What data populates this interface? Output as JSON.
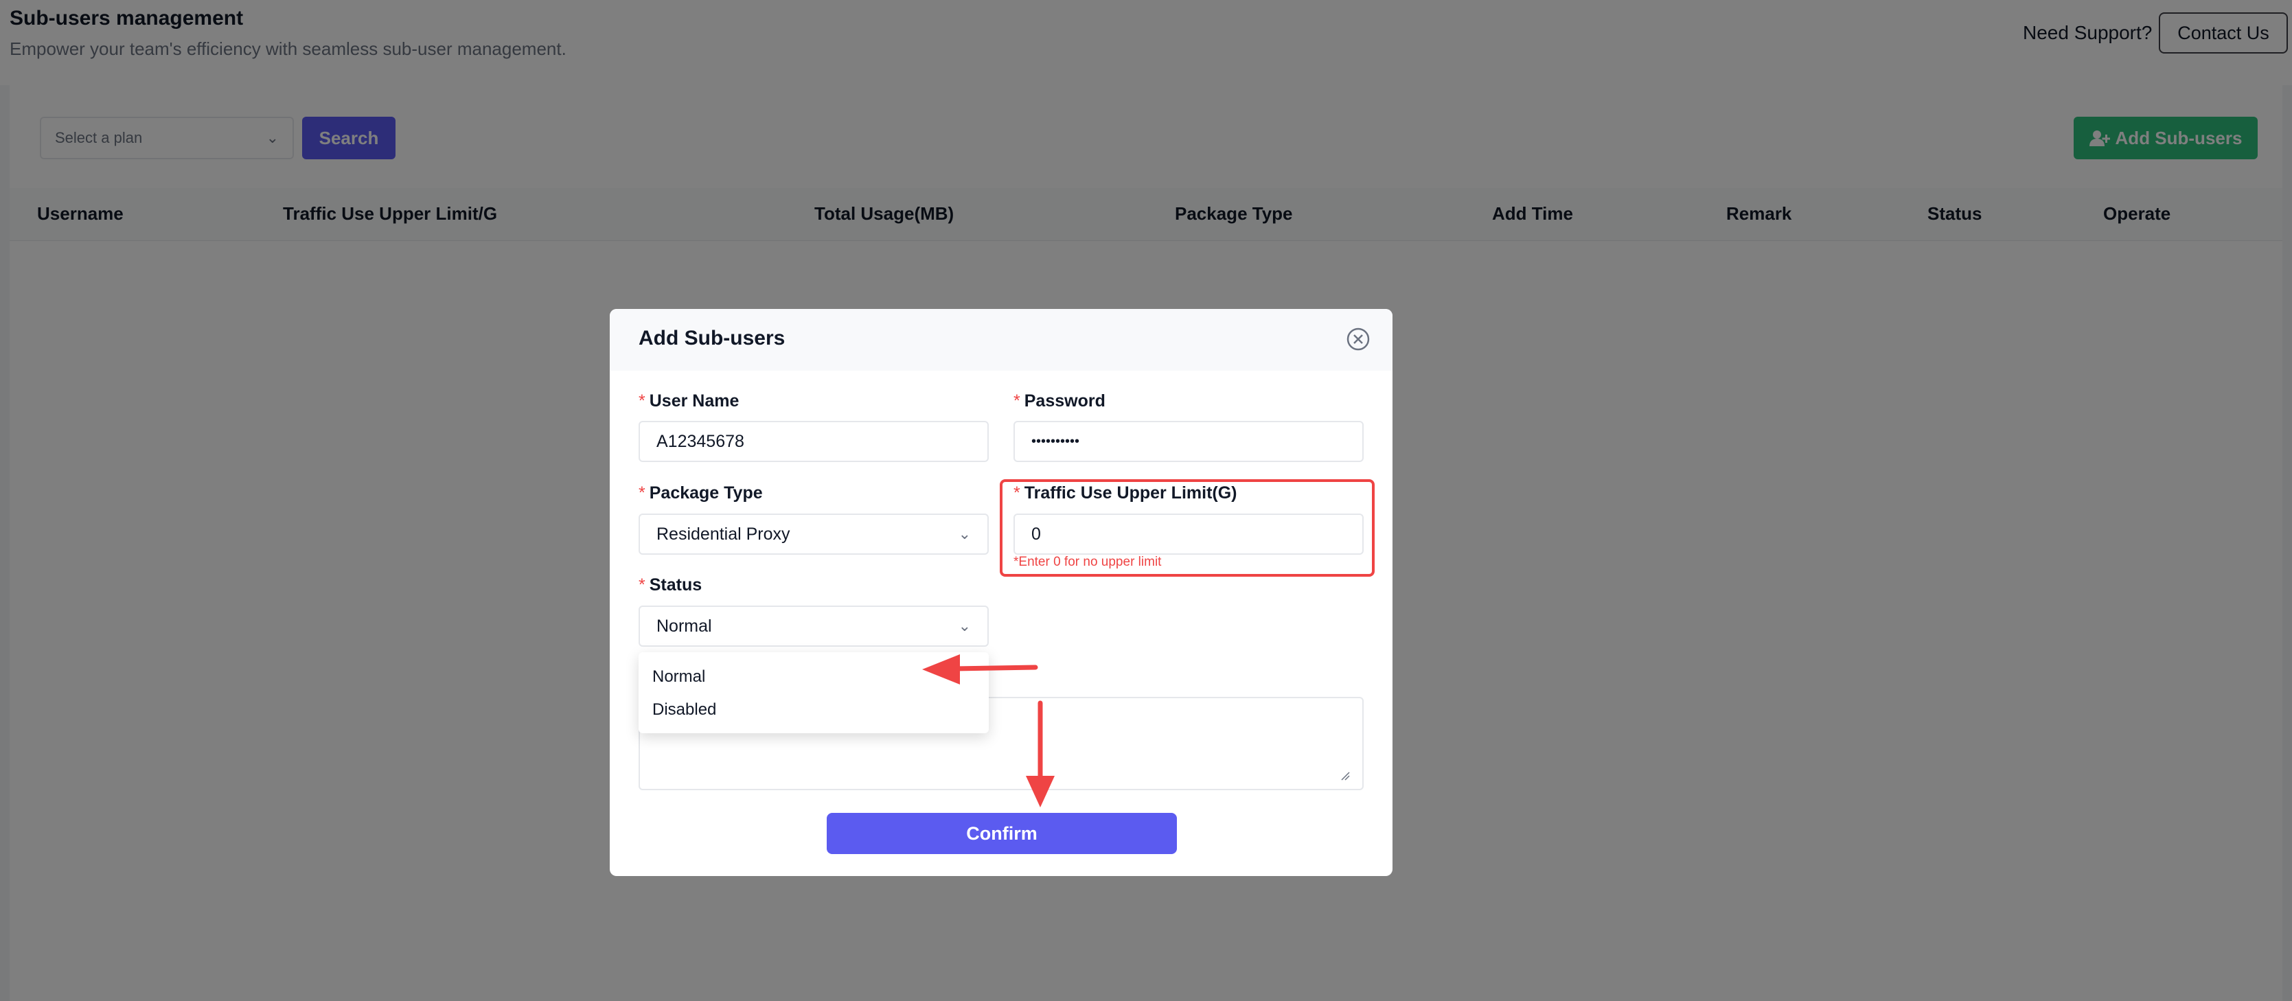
{
  "header": {
    "title": "Sub-users management",
    "subtitle": "Empower your team's efficiency with seamless sub-user management.",
    "support_text": "Need Support?",
    "contact_label": "Contact Us"
  },
  "toolbar": {
    "plan_placeholder": "Select a plan",
    "search_label": "Search",
    "add_label": "Add Sub-users"
  },
  "table": {
    "columns": [
      "Username",
      "Traffic Use Upper Limit/G",
      "Total Usage(MB)",
      "Package Type",
      "Add Time",
      "Remark",
      "Status",
      "Operate"
    ]
  },
  "modal": {
    "title": "Add Sub-users",
    "username_label": "User Name",
    "username_value": "A12345678",
    "password_label": "Password",
    "password_value": "••••••••••",
    "package_label": "Package Type",
    "package_value": "Residential Proxy",
    "traffic_label": "Traffic Use Upper Limit(G)",
    "traffic_value": "0",
    "traffic_hint": "*Enter 0 for no upper limit",
    "status_label": "Status",
    "status_value": "Normal",
    "status_options": [
      "Normal",
      "Disabled"
    ],
    "confirm_label": "Confirm"
  },
  "colors": {
    "primary": "#5b5bf0",
    "success": "#2fbe7c",
    "required": "#ef4444",
    "annotation": "#ef4444"
  }
}
